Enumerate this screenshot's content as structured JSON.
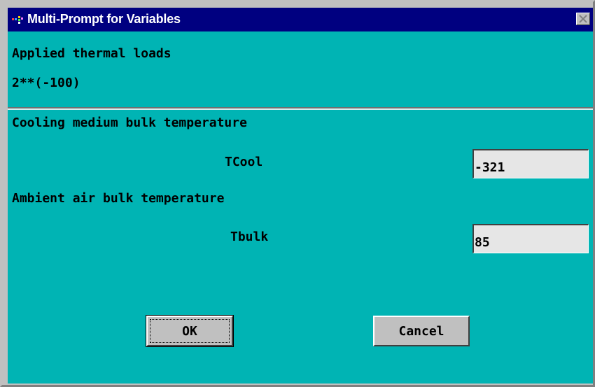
{
  "window": {
    "title": "Multi-Prompt for Variables"
  },
  "header": {
    "line1": "Applied thermal loads",
    "line2": "2**(-100)"
  },
  "prompts": [
    {
      "section_label": "Cooling medium bulk temperature",
      "variable_label": "TCool",
      "value": "-321"
    },
    {
      "section_label": "Ambient air bulk temperature",
      "variable_label": "Tbulk",
      "value": "85"
    }
  ],
  "buttons": {
    "ok_label": "OK",
    "cancel_label": "Cancel"
  },
  "colors": {
    "title_bar": "#000080",
    "client_background": "#00b4b4",
    "field_background": "#e6e6e6",
    "button_face": "#c0c0c0"
  }
}
